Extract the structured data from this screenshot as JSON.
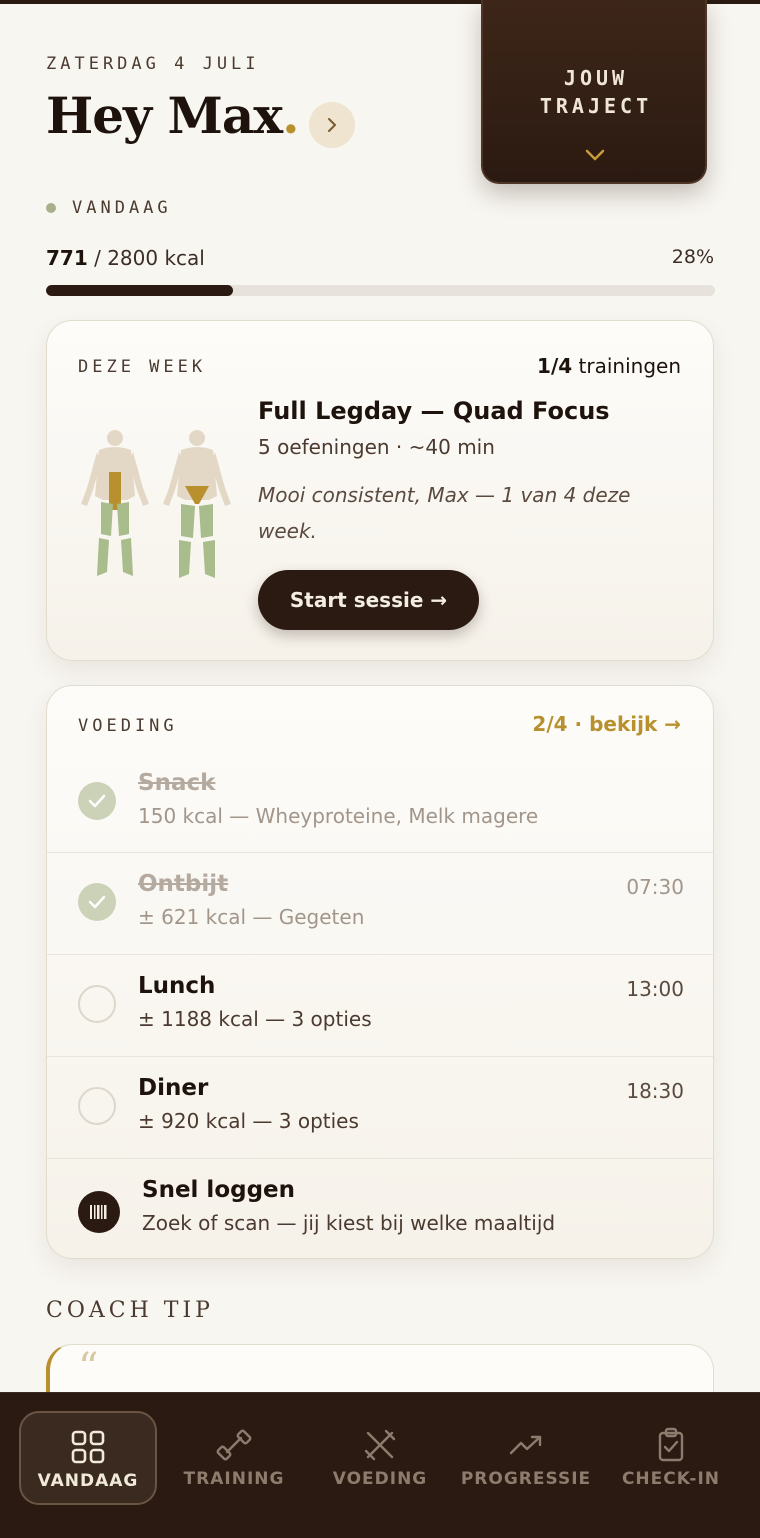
{
  "header": {
    "date": "ZATERDAG 4 JULI",
    "greeting": "Hey Max",
    "greeting_dot": ".",
    "traject_label": "JOUW\nTRAJECT",
    "today_label": "VANDAAG"
  },
  "calories": {
    "consumed": "771",
    "total": " / 2800 kcal",
    "percent_text": "28%",
    "progress": 0.28
  },
  "week": {
    "label": "DEZE WEEK",
    "count": "1/4",
    "count_suffix": " trainingen",
    "title": "Full Legday — Quad Focus",
    "meta": "5 oefeningen · ~40 min",
    "quote": "Mooi consistent, Max — 1 van 4 deze week.",
    "start_button": "Start sessie →"
  },
  "food": {
    "label": "VOEDING",
    "link": "2/4 · bekijk →",
    "meals": [
      {
        "name": "Snack",
        "sub": "150 kcal — Wheyproteine, Melk magere",
        "time": "",
        "done": true
      },
      {
        "name": "Ontbijt",
        "sub": "± 621 kcal — Gegeten",
        "time": "07:30",
        "done": true
      },
      {
        "name": "Lunch",
        "sub": "± 1188 kcal — 3 opties",
        "time": "13:00",
        "done": false
      },
      {
        "name": "Diner",
        "sub": "± 920 kcal — 3 opties",
        "time": "18:30",
        "done": false
      }
    ],
    "quick_log": {
      "name": "Snel loggen",
      "sub": "Zoek of scan — jij kiest bij welke maaltijd"
    }
  },
  "coach": {
    "label": "COACH TIP",
    "quote_mark": "“"
  },
  "nav": {
    "items": [
      {
        "label": "VANDAAG",
        "icon": "grid-icon"
      },
      {
        "label": "TRAINING",
        "icon": "dumbbell-icon"
      },
      {
        "label": "VOEDING",
        "icon": "fork-knife-icon"
      },
      {
        "label": "PROGRESSIE",
        "icon": "trending-up-icon"
      },
      {
        "label": "CHECK-IN",
        "icon": "clipboard-check-icon"
      }
    ]
  },
  "colors": {
    "accent": "#b8902e",
    "dark": "#2a1a12",
    "background": "#f8f6f1",
    "done": "#ccd2b8"
  }
}
